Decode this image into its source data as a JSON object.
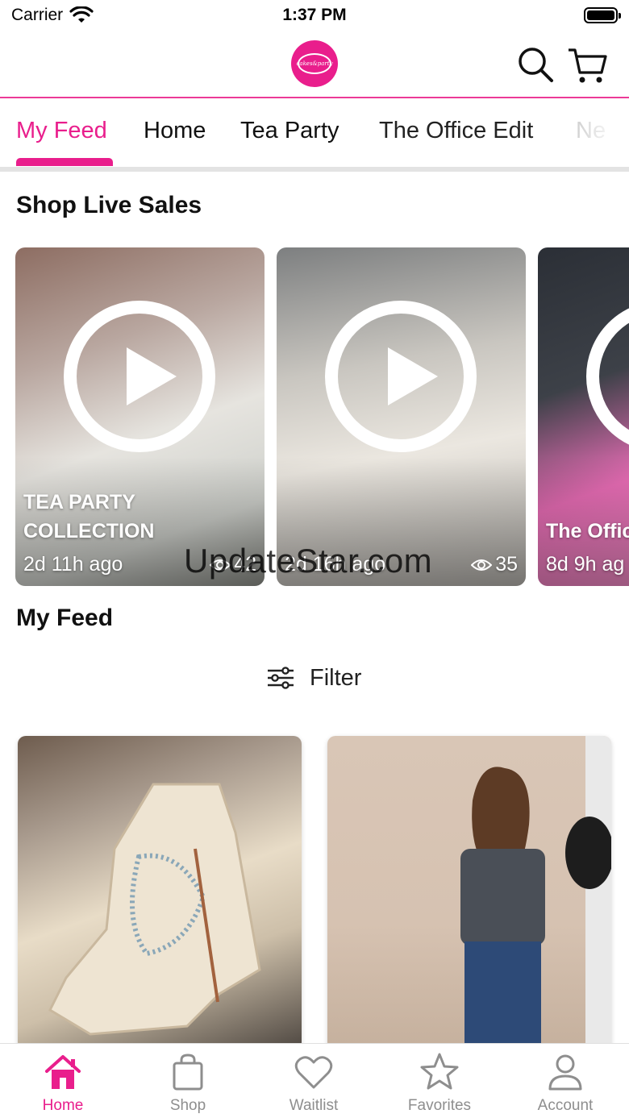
{
  "status_bar": {
    "carrier": "Carrier",
    "time": "1:37 PM"
  },
  "header": {
    "logo_text": "cakes&party"
  },
  "tabs": [
    "My Feed",
    "Home",
    "Tea Party",
    "The Office Edit",
    "Ne"
  ],
  "live_sales": {
    "title": "Shop Live Sales",
    "cards": [
      {
        "title_line1": "TEA PARTY",
        "title_line2": "COLLECTION",
        "time": "2d 11h ago",
        "views": "42"
      },
      {
        "title_line1": "",
        "title_line2": "",
        "time": "2d 16h ago",
        "views": "35"
      },
      {
        "title_line1": "",
        "title_line2": "The Offic",
        "time": "8d 9h ag",
        "views": ""
      }
    ]
  },
  "watermark": "UpdateStar.com",
  "feed": {
    "title": "My Feed",
    "filter_label": "Filter"
  },
  "tab_bar": {
    "items": [
      {
        "label": "Home",
        "icon": "home-icon"
      },
      {
        "label": "Shop",
        "icon": "shopping-bag-icon"
      },
      {
        "label": "Waitlist",
        "icon": "heart-icon"
      },
      {
        "label": "Favorites",
        "icon": "star-icon"
      },
      {
        "label": "Account",
        "icon": "person-icon"
      }
    ]
  },
  "colors": {
    "brand": "#e91e8c",
    "inactive": "#8e8e8e"
  }
}
